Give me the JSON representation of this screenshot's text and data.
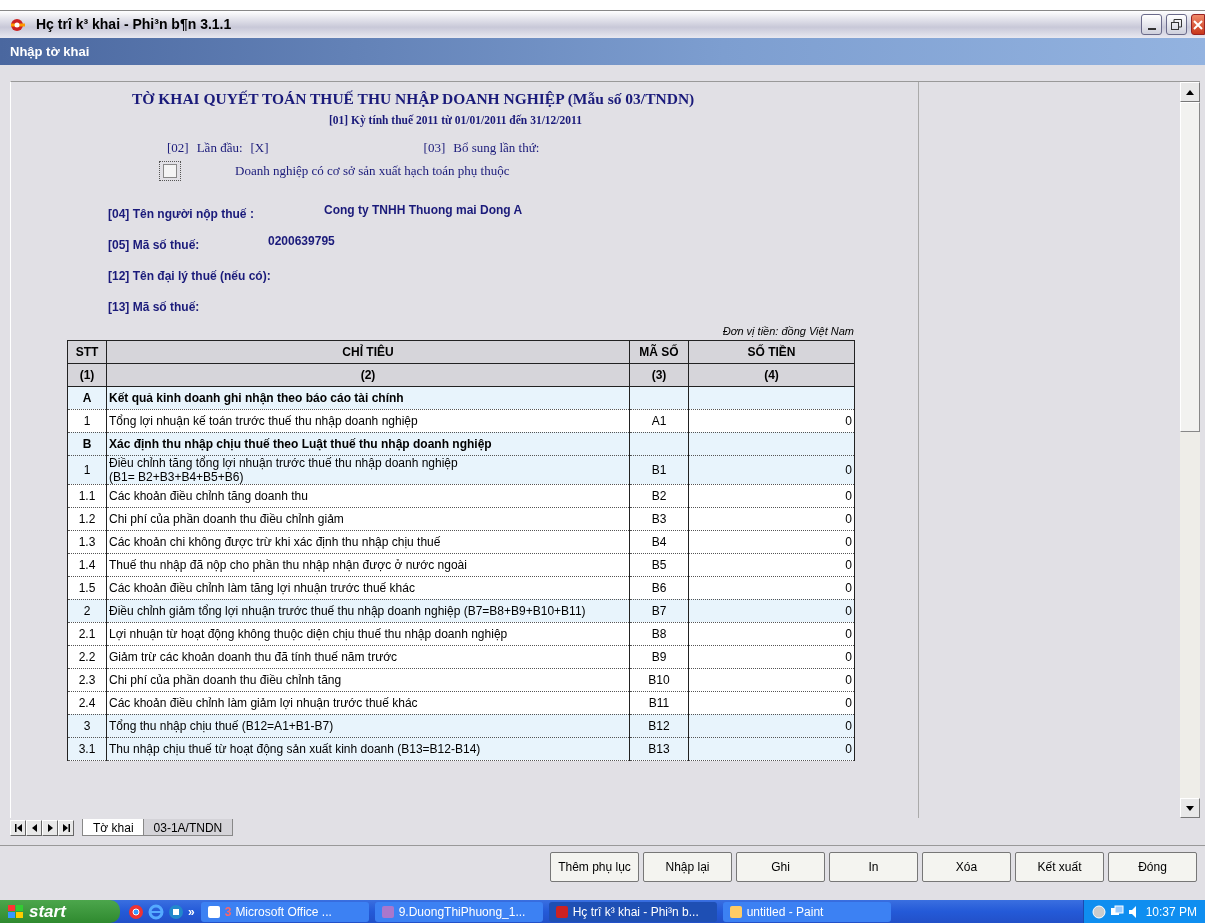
{
  "window": {
    "title": "Hç trî k³ khai - Phi³n b¶n 3.1.1"
  },
  "header": {
    "title": "Nhập tờ khai"
  },
  "form": {
    "title": "TỜ KHAI QUYẾT TOÁN THUẾ THU NHẬP DOANH NGHIỆP (Mẫu số 03/TNDN)",
    "period": "[01] Kỳ tính thuế 2011 từ 01/01/2011 đến 31/12/2011",
    "first_time": {
      "code": "[02]",
      "label": "Lần đầu:",
      "value": "[X]"
    },
    "supplement": {
      "code": "[03]",
      "label": "Bổ sung lần thứ:"
    },
    "dependent": {
      "label": "Doanh nghiệp có cơ sở sản xuất hạch toán phụ thuộc",
      "checked": false
    },
    "fields": [
      {
        "label": "[04] Tên người nộp thuế :",
        "value": "Cong ty TNHH Thuong mai Dong A"
      },
      {
        "label": "[05] Mã số thuế:",
        "value": "0200639795"
      },
      {
        "label": "[12] Tên đại lý thuế (nếu có):"
      },
      {
        "label": "[13] Mã số thuế:"
      }
    ],
    "currency_note": "Đơn vị tiền: đồng Việt Nam"
  },
  "table": {
    "columns": [
      "STT",
      "CHỈ TIÊU",
      "MÃ SỐ",
      "SỐ TIỀN"
    ],
    "column_numbers": [
      "(1)",
      "(2)",
      "(3)",
      "(4)"
    ],
    "rows": [
      {
        "kind": "section",
        "stt": "A",
        "label": "Kết quả kinh doanh ghi nhận theo báo cáo tài chính"
      },
      {
        "kind": "item",
        "stt": "1",
        "label": "Tổng lợi nhuận kế toán trước thuế thu nhập doanh nghiệp",
        "code": "A1",
        "value": "0"
      },
      {
        "kind": "section",
        "stt": "B",
        "label": "Xác định thu nhập chịu thuế theo Luật thuế thu nhập doanh nghiệp"
      },
      {
        "kind": "group",
        "stt": "1",
        "label": "Điều chỉnh tăng tổng lợi nhuận trước thuế thu nhập doanh nghiệp\n(B1= B2+B3+B4+B5+B6)",
        "code": "B1",
        "value": "0"
      },
      {
        "kind": "item",
        "stt": "1.1",
        "label": "Các khoản điều chỉnh tăng doanh thu",
        "code": "B2",
        "value": "0"
      },
      {
        "kind": "item",
        "stt": "1.2",
        "label": "Chi phí của phần doanh thu điều chỉnh giảm",
        "code": "B3",
        "value": "0"
      },
      {
        "kind": "item",
        "stt": "1.3",
        "label": "Các khoản chi không được trừ khi xác định thu nhập chịu thuế",
        "code": "B4",
        "value": "0"
      },
      {
        "kind": "item",
        "stt": "1.4",
        "label": "Thuế thu nhập đã nộp cho phần thu nhập nhận được ở nước ngoài",
        "code": "B5",
        "value": "0"
      },
      {
        "kind": "item",
        "stt": "1.5",
        "label": "Các khoản điều chỉnh làm tăng lợi nhuận trước thuế khác",
        "code": "B6",
        "value": "0"
      },
      {
        "kind": "group",
        "stt": "2",
        "label": "Điều chỉnh giảm tổng lợi nhuận trước thuế thu nhập doanh nghiệp (B7=B8+B9+B10+B11)",
        "code": "B7",
        "value": "0"
      },
      {
        "kind": "item",
        "stt": "2.1",
        "label": "Lợi nhuận từ hoạt động không thuộc diện chịu thuế thu nhập doanh nghiệp",
        "code": "B8",
        "value": "0"
      },
      {
        "kind": "item",
        "stt": "2.2",
        "label": "Giảm trừ các khoản doanh thu đã tính thuế năm trước",
        "code": "B9",
        "value": "0"
      },
      {
        "kind": "item",
        "stt": "2.3",
        "label": "Chi phí của phần doanh thu điều chỉnh tăng",
        "code": "B10",
        "value": "0"
      },
      {
        "kind": "item",
        "stt": "2.4",
        "label": "Các khoản điều chỉnh làm giảm lợi nhuận trước thuế khác",
        "code": "B11",
        "value": "0"
      },
      {
        "kind": "group",
        "stt": "3",
        "label": "Tổng thu nhập chịu thuế (B12=A1+B1-B7)",
        "code": "B12",
        "value": "0"
      },
      {
        "kind": "group",
        "stt": "3.1",
        "label": "Thu nhập chịu thuế từ hoạt động sản xuất kinh doanh (B13=B12-B14)",
        "code": "B13",
        "value": "0"
      }
    ]
  },
  "sheet_tabs": [
    {
      "label": "Tờ khai",
      "selected": true
    },
    {
      "label": "03-1A/TNDN",
      "selected": false
    }
  ],
  "buttons": [
    "Thêm phụ lục",
    "Nhập lại",
    "Ghi",
    "In",
    "Xóa",
    "Kết xuất",
    "Đóng"
  ],
  "taskbar": {
    "start": "start",
    "more": "»",
    "tasks": [
      {
        "count": "3",
        "label": "Microsoft Office ...",
        "selected": false
      },
      {
        "label": "9.DuongThiPhuong_1...",
        "selected": false
      },
      {
        "label": "Hç trî k³ khai - Phi³n b...",
        "selected": true
      },
      {
        "label": "untitled - Paint",
        "selected": false
      }
    ],
    "clock": "10:37 PM"
  }
}
